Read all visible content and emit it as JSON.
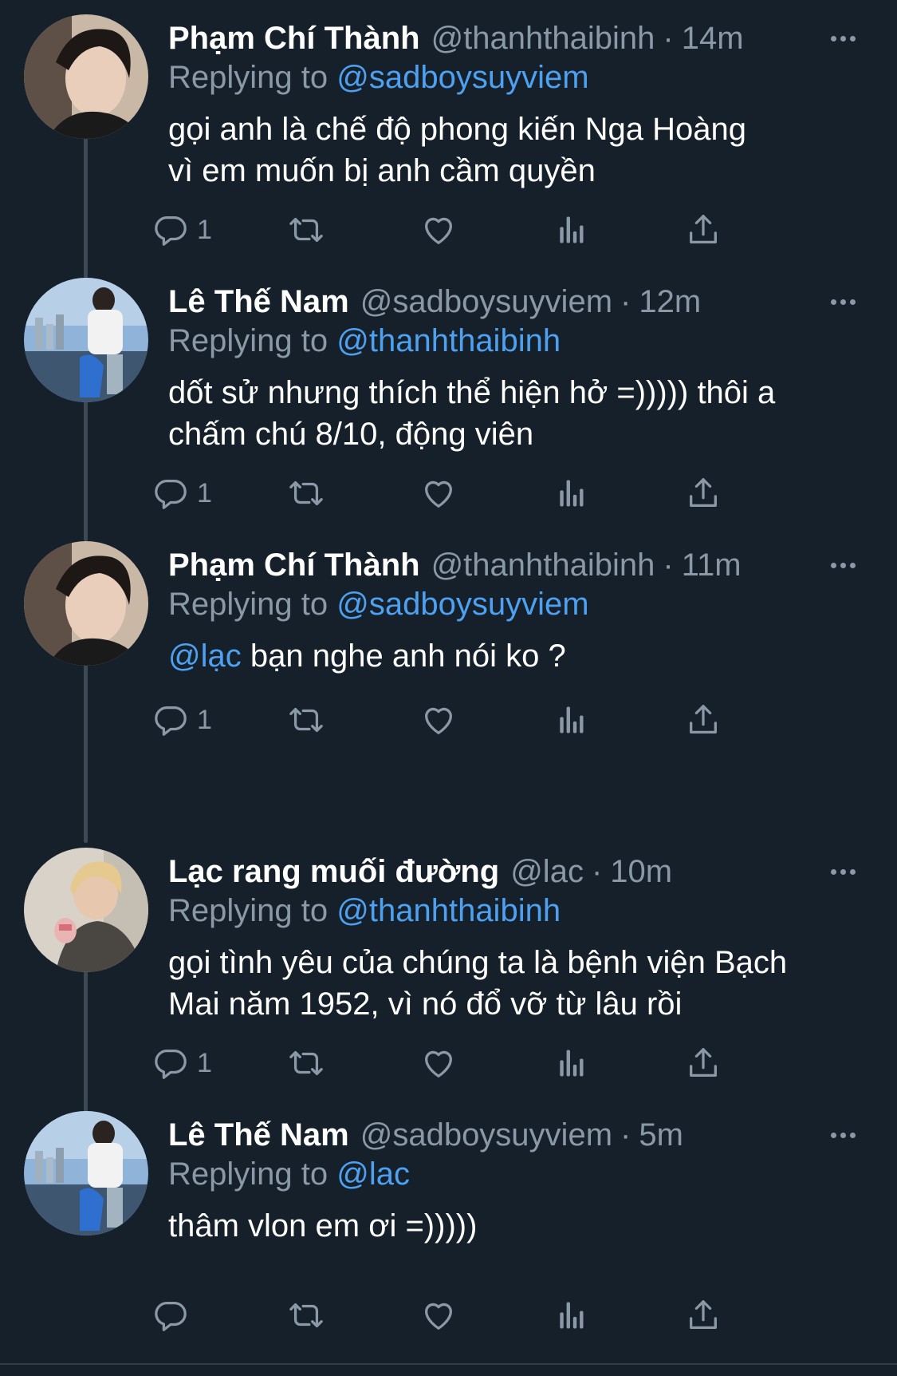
{
  "tweets": [
    {
      "name": "Phạm Chí Thành",
      "handle": "@thanhthaibinh",
      "dot": "·",
      "time": "14m",
      "replying_label": "Replying to",
      "replying_to": "@sadboysuyviem",
      "body_lines": [
        "gọi anh là chế độ phong kiến Nga Hoàng",
        "vì em muốn bị anh cầm quyền"
      ],
      "reply_count": "1",
      "avatar": "avatar-dark-hair"
    },
    {
      "name": "Lê Thế Nam",
      "handle": "@sadboysuyviem",
      "dot": "·",
      "time": "12m",
      "replying_label": "Replying to",
      "replying_to": "@thanhthaibinh",
      "body_lines": [
        "dốt sử nhưng thích thể hiện hở =))))) thôi a",
        "chấm chú 8/10, động viên"
      ],
      "reply_count": "1",
      "avatar": "avatar-seaside"
    },
    {
      "name": "Phạm Chí Thành",
      "handle": "@thanhthaibinh",
      "dot": "·",
      "time": "11m",
      "replying_label": "Replying to",
      "replying_to": "@sadboysuyviem",
      "body_mention": "@lạc",
      "body_rest": " bạn nghe anh nói ko ?",
      "reply_count": "1",
      "avatar": "avatar-dark-hair"
    },
    {
      "name": "Lạc rang muối đường",
      "handle": "@lac",
      "dot": "·",
      "time": "10m",
      "replying_label": "Replying to",
      "replying_to": "@thanhthaibinh",
      "body_lines": [
        "gọi tình yêu của chúng ta là bệnh viện Bạch",
        "Mai năm 1952, vì nó đổ vỡ từ lâu rồi"
      ],
      "reply_count": "1",
      "avatar": "avatar-blond"
    },
    {
      "name": "Lê Thế Nam",
      "handle": "@sadboysuyviem",
      "dot": "·",
      "time": "5m",
      "replying_label": "Replying to",
      "replying_to": "@lac",
      "body_lines": [
        "thâm vlon em ơi =)))))"
      ],
      "reply_count": "",
      "avatar": "avatar-seaside"
    }
  ],
  "icons": {
    "reply": "reply-icon",
    "retweet": "retweet-icon",
    "like": "heart-icon",
    "views": "analytics-icon",
    "share": "share-icon",
    "more": "more-icon"
  },
  "colors": {
    "background": "#15202b",
    "name": "#ffffff",
    "secondary": "#8b98a5",
    "link": "#4da1f0",
    "thread_line": "#3d4a56"
  }
}
